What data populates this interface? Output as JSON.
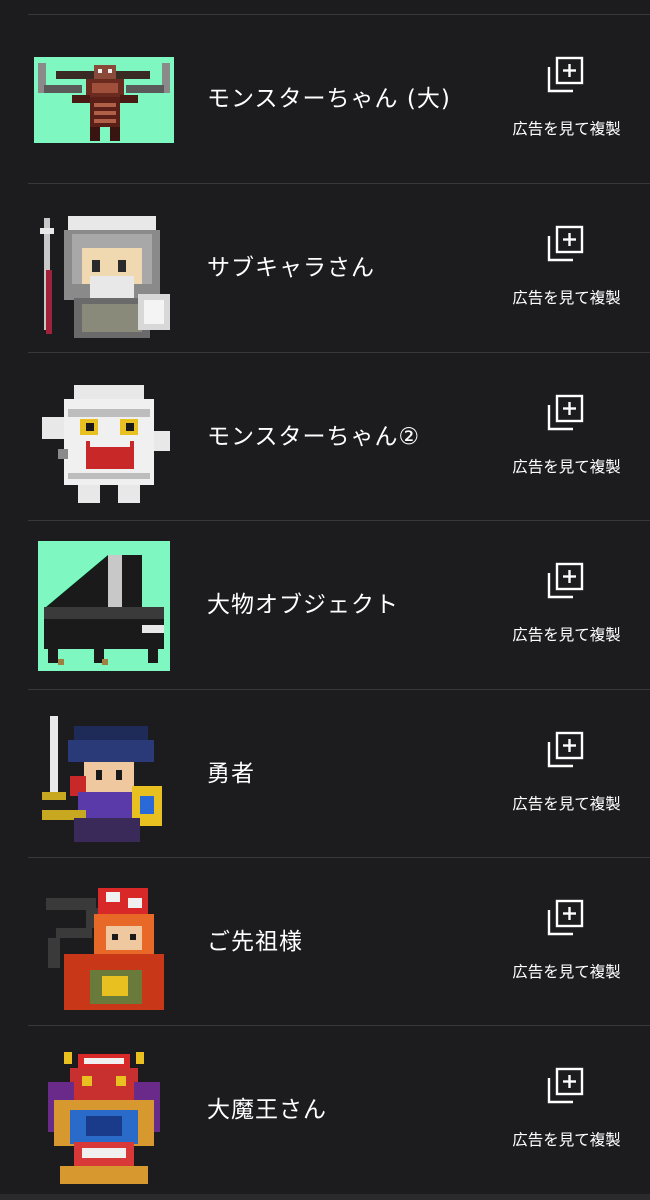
{
  "items": [
    {
      "name": "モンスターちゃん (大)",
      "action_label": "広告を見て複製",
      "thumbnail": "demon-boss-sprite",
      "thumb_bg": "#7ef7c0"
    },
    {
      "name": "サブキャラさん",
      "action_label": "広告を見て複製",
      "thumbnail": "old-sage-sprite",
      "thumb_bg": ""
    },
    {
      "name": "モンスターちゃん②",
      "action_label": "広告を見て複製",
      "thumbnail": "mummy-monster-sprite",
      "thumb_bg": ""
    },
    {
      "name": "大物オブジェクト",
      "action_label": "広告を見て複製",
      "thumbnail": "grand-piano-sprite",
      "thumb_bg": "#7ef7c0"
    },
    {
      "name": "勇者",
      "action_label": "広告を見て複製",
      "thumbnail": "hero-sprite",
      "thumb_bg": ""
    },
    {
      "name": "ご先祖様",
      "action_label": "広告を見て複製",
      "thumbnail": "ancestor-ghost-sprite",
      "thumb_bg": ""
    },
    {
      "name": "大魔王さん",
      "action_label": "広告を見て複製",
      "thumbnail": "demon-lord-sprite",
      "thumb_bg": ""
    }
  ],
  "icons": {
    "duplicate": "duplicate-plus-icon"
  },
  "colors": {
    "background": "#1c1c1e",
    "divider": "#38383a",
    "text": "#ffffff",
    "thumb_green": "#7ef7c0"
  }
}
